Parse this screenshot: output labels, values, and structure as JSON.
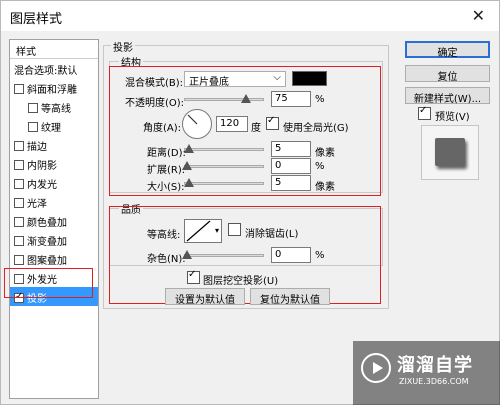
{
  "window": {
    "title": "图层样式",
    "close_icon": "close-icon"
  },
  "sidebar": {
    "header": "样式",
    "items": [
      {
        "label": "混合选项:默认",
        "checkbox": false,
        "checked": false,
        "sub": false
      },
      {
        "label": "斜面和浮雕",
        "checkbox": true,
        "checked": false,
        "sub": false
      },
      {
        "label": "等高线",
        "checkbox": true,
        "checked": false,
        "sub": true
      },
      {
        "label": "纹理",
        "checkbox": true,
        "checked": false,
        "sub": true
      },
      {
        "label": "描边",
        "checkbox": true,
        "checked": false,
        "sub": false
      },
      {
        "label": "内阴影",
        "checkbox": true,
        "checked": false,
        "sub": false
      },
      {
        "label": "内发光",
        "checkbox": true,
        "checked": false,
        "sub": false
      },
      {
        "label": "光泽",
        "checkbox": true,
        "checked": false,
        "sub": false
      },
      {
        "label": "颜色叠加",
        "checkbox": true,
        "checked": false,
        "sub": false
      },
      {
        "label": "渐变叠加",
        "checkbox": true,
        "checked": false,
        "sub": false
      },
      {
        "label": "图案叠加",
        "checkbox": true,
        "checked": false,
        "sub": false
      },
      {
        "label": "外发光",
        "checkbox": true,
        "checked": false,
        "sub": false
      },
      {
        "label": "投影",
        "checkbox": true,
        "checked": true,
        "sub": false,
        "selected": true
      }
    ]
  },
  "drop_shadow": {
    "group_title": "投影",
    "structure": {
      "title": "结构",
      "blend_mode_label": "混合模式(B):",
      "blend_mode_value": "正片叠底",
      "shadow_color": "#000000",
      "opacity_label": "不透明度(O):",
      "opacity_value": "75",
      "opacity_unit": "%",
      "angle_label": "角度(A):",
      "angle_value": "120",
      "angle_unit": "度",
      "global_light_label": "使用全局光(G)",
      "global_light_checked": true,
      "distance_label": "距离(D):",
      "distance_value": "5",
      "distance_unit": "像素",
      "spread_label": "扩展(R):",
      "spread_value": "0",
      "spread_unit": "%",
      "size_label": "大小(S):",
      "size_value": "5",
      "size_unit": "像素"
    },
    "quality": {
      "title": "品质",
      "contour_label": "等高线:",
      "anti_alias_label": "消除锯齿(L)",
      "anti_alias_checked": false,
      "noise_label": "杂色(N):",
      "noise_value": "0",
      "noise_unit": "%"
    },
    "knockout_label": "图层挖空投影(U)",
    "knockout_checked": true,
    "make_default_label": "设置为默认值",
    "reset_default_label": "复位为默认值"
  },
  "right_buttons": {
    "ok": "确定",
    "reset": "复位",
    "new_style": "新建样式(W)...",
    "preview_label": "预览(V)",
    "preview_checked": true
  },
  "watermark": {
    "brand": "溜溜自学",
    "url": "ZIXUE.3D66.COM"
  }
}
